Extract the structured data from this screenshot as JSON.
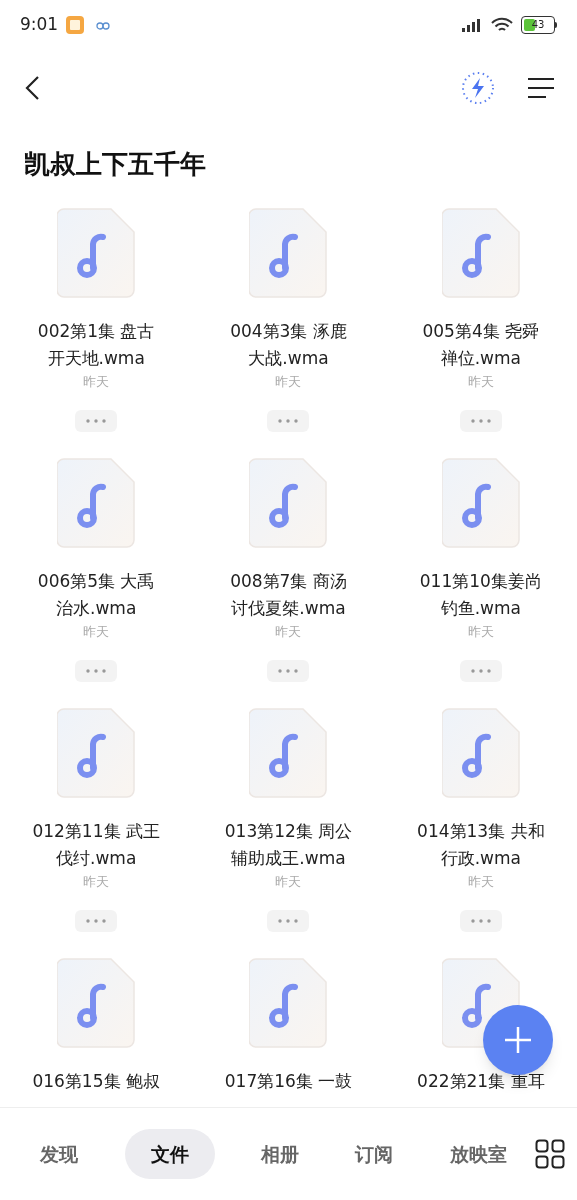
{
  "status_bar": {
    "time": "9:01",
    "battery": "43"
  },
  "title": "凯叔上下五千年",
  "files": [
    {
      "name_lines": [
        "002第1集 盘古",
        "开天地.wma"
      ],
      "date": "昨天"
    },
    {
      "name_lines": [
        "004第3集 涿鹿",
        "大战.wma"
      ],
      "date": "昨天"
    },
    {
      "name_lines": [
        "005第4集 尧舜",
        "禅位.wma"
      ],
      "date": "昨天"
    },
    {
      "name_lines": [
        "006第5集 大禹",
        "治水.wma"
      ],
      "date": "昨天"
    },
    {
      "name_lines": [
        "008第7集 商汤",
        "讨伐夏桀.wma"
      ],
      "date": "昨天"
    },
    {
      "name_lines": [
        "011第10集姜尚",
        "钓鱼.wma"
      ],
      "date": "昨天"
    },
    {
      "name_lines": [
        "012第11集 武王",
        "伐纣.wma"
      ],
      "date": "昨天"
    },
    {
      "name_lines": [
        "013第12集 周公",
        "辅助成王.wma"
      ],
      "date": "昨天"
    },
    {
      "name_lines": [
        "014第13集 共和",
        "行政.wma"
      ],
      "date": "昨天"
    },
    {
      "name_lines": [
        "016第15集 鲍叔"
      ]
    },
    {
      "name_lines": [
        "017第16集 一鼓"
      ]
    },
    {
      "name_lines": [
        "022第21集 重耳"
      ]
    }
  ],
  "bottom_nav": [
    {
      "label": "发现",
      "selected": false
    },
    {
      "label": "文件",
      "selected": true
    },
    {
      "label": "相册",
      "selected": false
    },
    {
      "label": "订阅",
      "selected": false
    },
    {
      "label": "放映室",
      "selected": false
    }
  ]
}
